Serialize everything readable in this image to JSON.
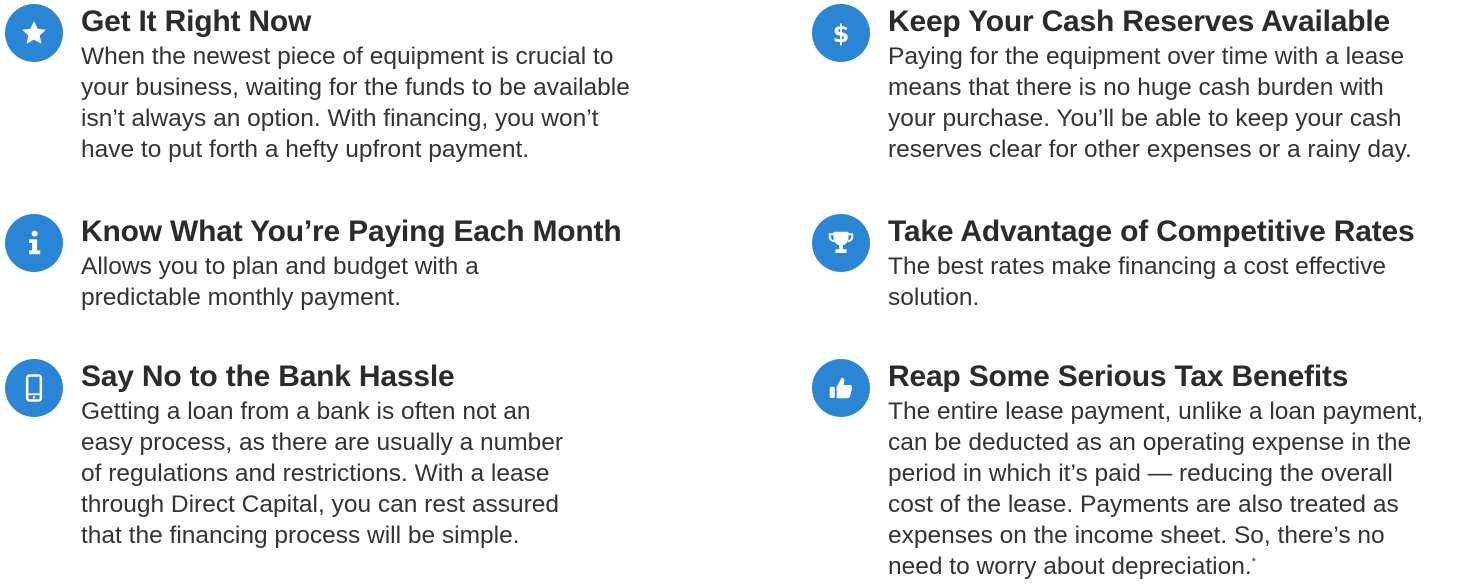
{
  "brand_color": "#2a86d4",
  "benefits": [
    {
      "icon": "star-icon",
      "title": "Get It Right Now",
      "desc": "When the newest piece of equipment is crucial to\nyour business, waiting for the funds to be available\nisn’t always an option. With financing, you won’t\nhave to put forth a hefty upfront payment."
    },
    {
      "icon": "info-icon",
      "title": "Know What You’re Paying Each Month",
      "desc": "Allows you to plan and budget with a\npredictable monthly payment."
    },
    {
      "icon": "smartphone-icon",
      "title": "Say No to the Bank Hassle",
      "desc": "Getting a loan from a bank is often not an\neasy process, as there are usually a number\nof regulations and restrictions. With a lease\nthrough Direct Capital, you can rest assured\nthat the financing process will be simple."
    },
    {
      "icon": "dollar-icon",
      "title": "Keep Your Cash Reserves Available",
      "desc": "Paying for the equipment over time with a lease\nmeans that there is no huge cash burden with\nyour purchase. You’ll be able to keep your cash\nreserves clear for other expenses or a rainy day."
    },
    {
      "icon": "trophy-icon",
      "title": "Take Advantage of Competitive Rates",
      "desc": "The best rates make financing a cost effective\nsolution."
    },
    {
      "icon": "thumbs-up-icon",
      "title": "Reap Some Serious Tax Benefits",
      "desc": "The entire lease payment, unlike a loan payment,\ncan be deducted as an operating expense in the\nperiod in which it’s paid — reducing the overall\ncost of the lease. Payments are also treated as\nexpenses on the income sheet. So, there’s no\nneed to worry about depreciation.",
      "footnote_mark": "*"
    }
  ]
}
